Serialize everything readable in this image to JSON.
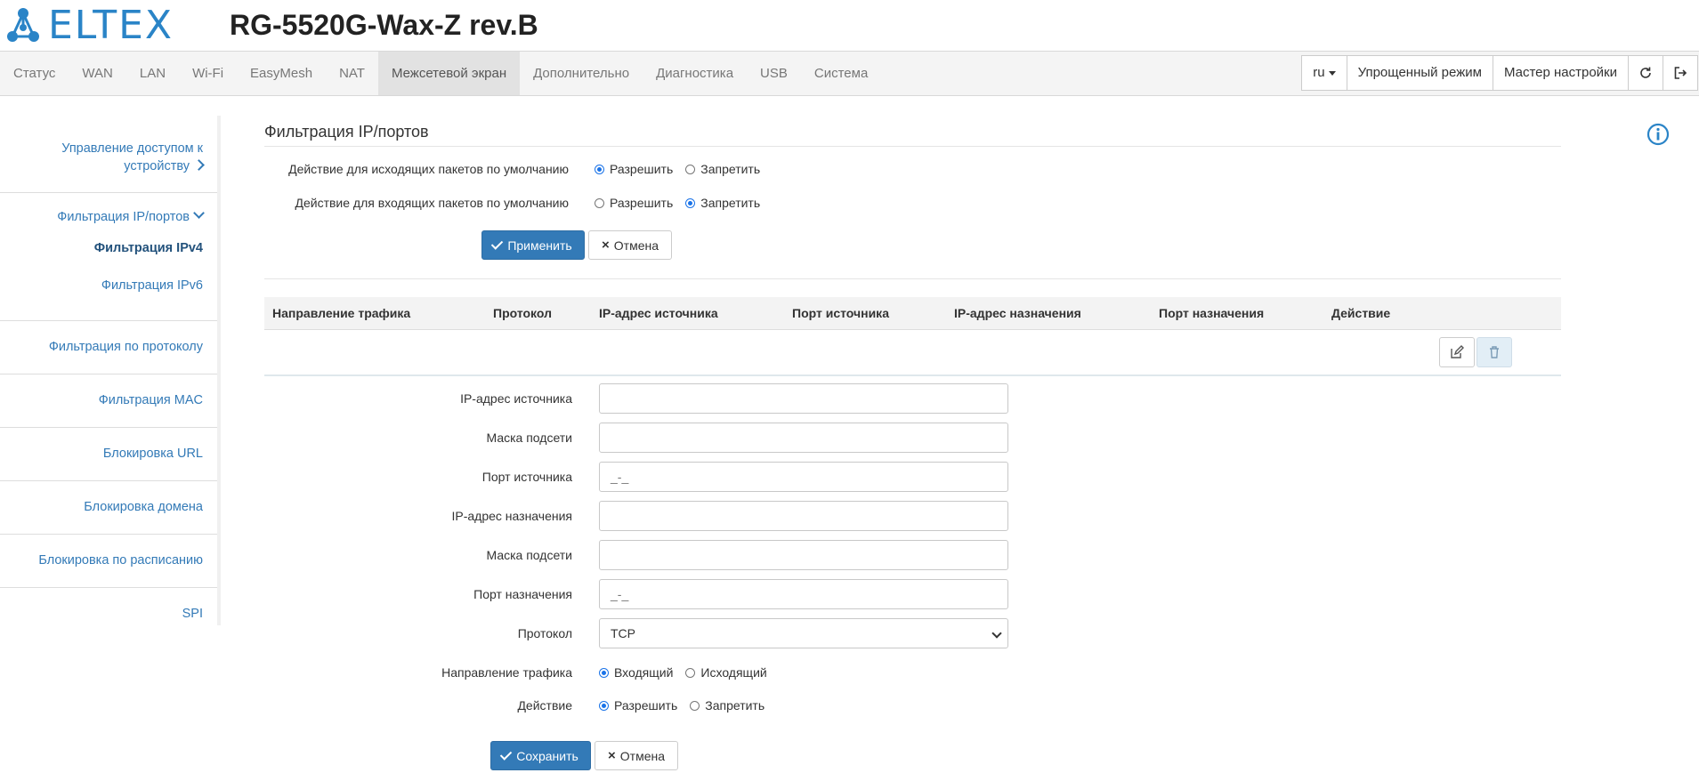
{
  "header": {
    "logo_text": "ELTEX",
    "device_title": "RG-5520G-Wax-Z rev.B"
  },
  "nav": {
    "items": [
      "Статус",
      "WAN",
      "LAN",
      "Wi-Fi",
      "EasyMesh",
      "NAT",
      "Межсетевой экран",
      "Дополнительно",
      "Диагностика",
      "USB",
      "Система"
    ],
    "active": "Межсетевой экран",
    "lang": "ru",
    "simple_mode": "Упрощенный режим",
    "wizard": "Мастер настройки",
    "refresh_icon": "refresh-icon",
    "logout_icon": "logout-icon"
  },
  "sidebar": {
    "access_control": "Управление доступом к устройству",
    "ip_filter": "Фильтрация IP/портов",
    "ipv4": "Фильтрация IPv4",
    "ipv6": "Фильтрация IPv6",
    "protocol_filter": "Фильтрация по протоколу",
    "mac_filter": "Фильтрация MAC",
    "url_block": "Блокировка URL",
    "domain_block": "Блокировка домена",
    "schedule_block": "Блокировка по расписанию",
    "spi": "SPI"
  },
  "main": {
    "title": "Фильтрация IP/портов",
    "outgoing_label": "Действие для исходящих пакетов по умолчанию",
    "incoming_label": "Действие для входящих пакетов по умолчанию",
    "allow": "Разрешить",
    "deny": "Запретить",
    "outgoing_selected": "allow",
    "incoming_selected": "deny",
    "apply": "Применить",
    "cancel": "Отмена"
  },
  "table": {
    "columns": [
      "Направление трафика",
      "Протокол",
      "IP-адрес источника",
      "Порт источника",
      "IP-адрес назначения",
      "Порт назначения",
      "Действие"
    ]
  },
  "form": {
    "src_ip": {
      "label": "IP-адрес источника",
      "value": ""
    },
    "src_mask": {
      "label": "Маска подсети",
      "value": ""
    },
    "src_port": {
      "label": "Порт источника",
      "value": "_-_"
    },
    "dst_ip": {
      "label": "IP-адрес назначения",
      "value": ""
    },
    "dst_mask": {
      "label": "Маска подсети",
      "value": ""
    },
    "dst_port": {
      "label": "Порт назначения",
      "value": "_-_"
    },
    "protocol": {
      "label": "Протокол",
      "value": "TCP"
    },
    "direction": {
      "label": "Направление трафика",
      "opt1": "Входящий",
      "opt2": "Исходящий",
      "selected": "in"
    },
    "action": {
      "label": "Действие",
      "opt1": "Разрешить",
      "opt2": "Запретить",
      "selected": "allow"
    },
    "save": "Сохранить",
    "cancel": "Отмена"
  },
  "colors": {
    "brand": "#2a84c7",
    "primary": "#337ab7",
    "link": "#337ab7"
  }
}
